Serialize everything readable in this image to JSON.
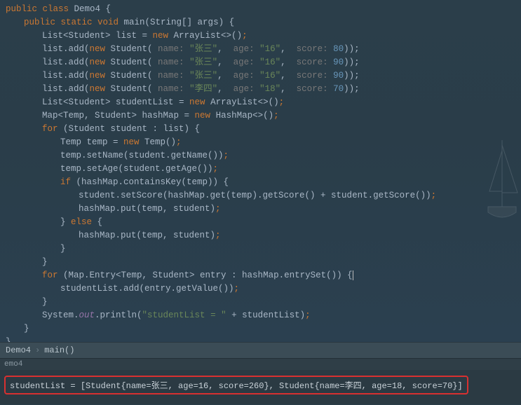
{
  "code": {
    "l1_kw1": "public class ",
    "l1_cls": "Demo4",
    "l1_brace": " {",
    "l2_kw": "public static void ",
    "l2_m": "main",
    "l2_p": "(String[] args) {",
    "l3a": "List<Student> list = ",
    "l3n": "new",
    "l3b": " ArrayList<>()",
    "l3s": ";",
    "l4a": "list.add(",
    "l4n": "new",
    "l4b": " Student(",
    "l4h1": " name: ",
    "l4s1": "\"张三\"",
    "l4c1": ", ",
    "l4h2": " age: ",
    "l4s2": "\"16\"",
    "l4c2": ", ",
    "l4h3": " score: ",
    "l4v": "80",
    "l4e": "));",
    "l5a": "list.add(",
    "l5n": "new",
    "l5b": " Student(",
    "l5h1": " name: ",
    "l5s1": "\"张三\"",
    "l5c1": ", ",
    "l5h2": " age: ",
    "l5s2": "\"16\"",
    "l5c2": ", ",
    "l5h3": " score: ",
    "l5v": "90",
    "l5e": "));",
    "l6a": "list.add(",
    "l6n": "new",
    "l6b": " Student(",
    "l6h1": " name: ",
    "l6s1": "\"张三\"",
    "l6c1": ", ",
    "l6h2": " age: ",
    "l6s2": "\"16\"",
    "l6c2": ", ",
    "l6h3": " score: ",
    "l6v": "90",
    "l6e": "));",
    "l7a": "list.add(",
    "l7n": "new",
    "l7b": " Student(",
    "l7h1": " name: ",
    "l7s1": "\"李四\"",
    "l7c1": ", ",
    "l7h2": " age: ",
    "l7s2": "\"18\"",
    "l7c2": ", ",
    "l7h3": " score: ",
    "l7v": "70",
    "l7e": "));",
    "l8a": "List<Student> studentList = ",
    "l8n": "new",
    "l8b": " ArrayList<>()",
    "l8s": ";",
    "l9a": "Map<Temp, Student> hashMap = ",
    "l9n": "new",
    "l9b": " HashMap<>()",
    "l9s": ";",
    "l10k": "for",
    "l10a": " (Student student : list) {",
    "l11a": "Temp temp = ",
    "l11n": "new",
    "l11b": " Temp()",
    "l11s": ";",
    "l12a": "temp.setName(student.getName())",
    "l12s": ";",
    "l13a": "temp.setAge(student.getAge())",
    "l13s": ";",
    "l14k": "if",
    "l14a": " (hashMap.containsKey(temp)) {",
    "l15a": "student.setScore(hashMap.get(temp).getScore() + student.getScore())",
    "l15s": ";",
    "l16a": "hashMap.put(temp, student)",
    "l16s": ";",
    "l17a": "} ",
    "l17k": "else",
    "l17b": " {",
    "l18a": "hashMap.put(temp, student)",
    "l18s": ";",
    "l19a": "}",
    "l20a": "}",
    "l21k": "for",
    "l21a": " (Map.Entry<Temp, Student> entry : hashMap.entrySet()) {",
    "l22a": "studentList.add(entry.getValue())",
    "l22s": ";",
    "l23a": "}",
    "l24a": "System.",
    "l24f": "out",
    "l24b": ".println(",
    "l24s": "\"studentList = \"",
    "l24c": " + studentList)",
    "l24e": ";",
    "l25a": "}",
    "l26a": "}"
  },
  "breadcrumb": {
    "item1": "Demo4",
    "sep": "›",
    "item2": "main()"
  },
  "tab": "emo4",
  "console": {
    "output": "studentList = [Student{name=张三, age=16, score=260}, Student{name=李四, age=18, score=70}]"
  }
}
